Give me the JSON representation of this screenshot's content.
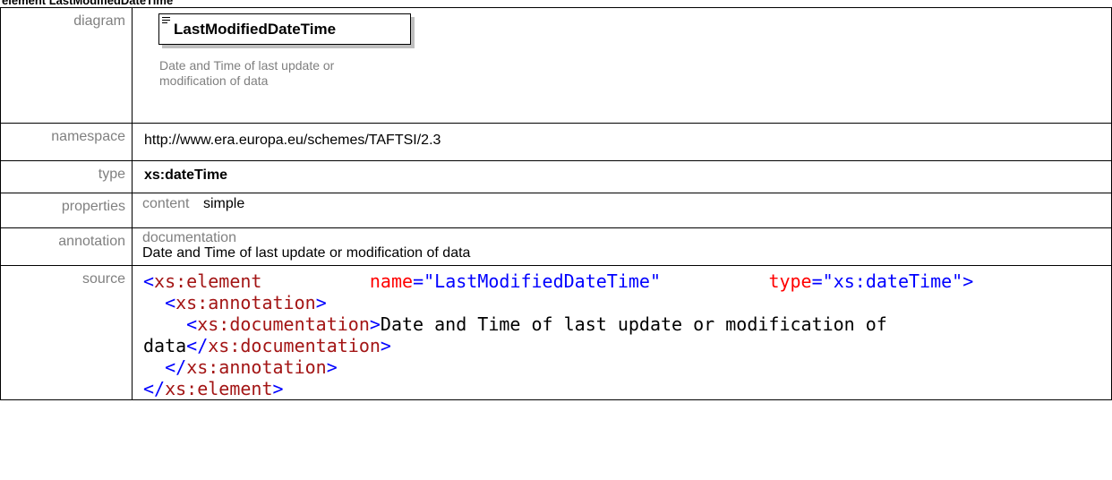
{
  "page": {
    "heading": "element LastModifiedDateTime"
  },
  "labels": {
    "diagram": "diagram",
    "namespace": "namespace",
    "type": "type",
    "properties": "properties",
    "annotation": "annotation",
    "source": "source"
  },
  "diagram": {
    "element_name": "LastModifiedDateTime",
    "doc_line1": "Date and Time of last update or",
    "doc_line2": "modification of data"
  },
  "namespace": "http://www.era.europa.eu/schemes/TAFTSI/2.3",
  "type": "xs:dateTime",
  "properties": {
    "key": "content",
    "value": "simple"
  },
  "annotation": {
    "key": "documentation",
    "value": "Date and Time of last update or modification of data"
  },
  "source": {
    "line1": {
      "open": "<",
      "tag": "xs:element",
      "name_attr": "name",
      "eq1": "=",
      "name_val": "\"LastModifiedDateTime\"",
      "type_attr": "type",
      "eq2": "=",
      "type_val": "\"xs:dateTime\"",
      "close": ">"
    },
    "line2": {
      "open": "<",
      "tag": "xs:annotation",
      "close": ">"
    },
    "line3": {
      "open": "<",
      "tag": "xs:documentation",
      "close": ">",
      "text": "Date and Time of last update or modification of"
    },
    "line4": {
      "text": "data",
      "open": "</",
      "tag": "xs:documentation",
      "close": ">"
    },
    "line5": {
      "open": "</",
      "tag": "xs:annotation",
      "close": ">"
    },
    "line6": {
      "open": "</",
      "tag": "xs:element",
      "close": ">"
    }
  },
  "colors": {
    "label_gray": "#808080",
    "xml_bracket": "#0000ff",
    "xml_element": "#a31515",
    "xml_attribute": "#ff0000",
    "xml_value": "#0000ff"
  }
}
